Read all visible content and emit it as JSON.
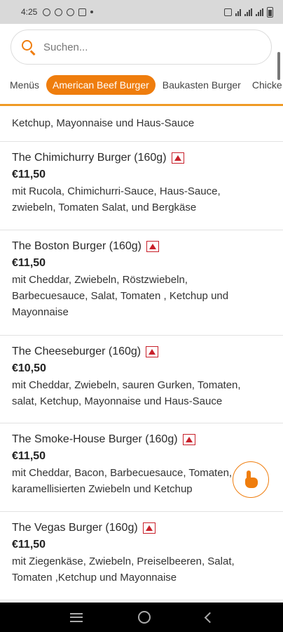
{
  "status_bar": {
    "time": "4:25"
  },
  "search": {
    "placeholder": "Suchen..."
  },
  "tabs": [
    "Menüs",
    "American Beef Burger",
    "Baukasten Burger",
    "Chicke"
  ],
  "partial_item": {
    "desc_line": "Ketchup, Mayonnaise und Haus-Sauce"
  },
  "items": [
    {
      "name": "The Chimichurry Burger (160g)",
      "price": "€11,50",
      "desc": [
        "mit Rucola, Chimichurri-Sauce, Haus-Sauce,",
        "zwiebeln, Tomaten Salat, und Bergkäse"
      ]
    },
    {
      "name": "The Boston Burger (160g)",
      "price": "€11,50",
      "desc": [
        "mit Cheddar, Zwiebeln, Röstzwiebeln,",
        "Barbecuesauce, Salat, Tomaten , Ketchup und",
        "Mayonnaise"
      ]
    },
    {
      "name": "The Cheeseburger (160g)",
      "price": "€10,50",
      "desc": [
        "mit Cheddar, Zwiebeln, sauren Gurken, Tomaten,",
        "salat, Ketchup, Mayonnaise und Haus-Sauce"
      ]
    },
    {
      "name": "The Smoke-House Burger (160g)",
      "price": "€11,50",
      "desc": [
        "mit Cheddar, Bacon, Barbecuesauce, Tomaten,",
        "karamellisierten Zwiebeln und Ketchup"
      ]
    },
    {
      "name": "The Vegas Burger (160g)",
      "price": "€11,50",
      "desc": [
        "mit Ziegenkäse, Zwiebeln, Preiselbeeren, Salat,",
        "Tomaten ,Ketchup und Mayonnaise"
      ]
    }
  ],
  "colors": {
    "accent": "#ef7d0d",
    "allergen": "#c8202a"
  },
  "icons": [
    "search-icon",
    "allergen-warning-icon",
    "hand-pointer-icon",
    "nav-menu-icon",
    "nav-home-icon",
    "nav-back-icon"
  ]
}
